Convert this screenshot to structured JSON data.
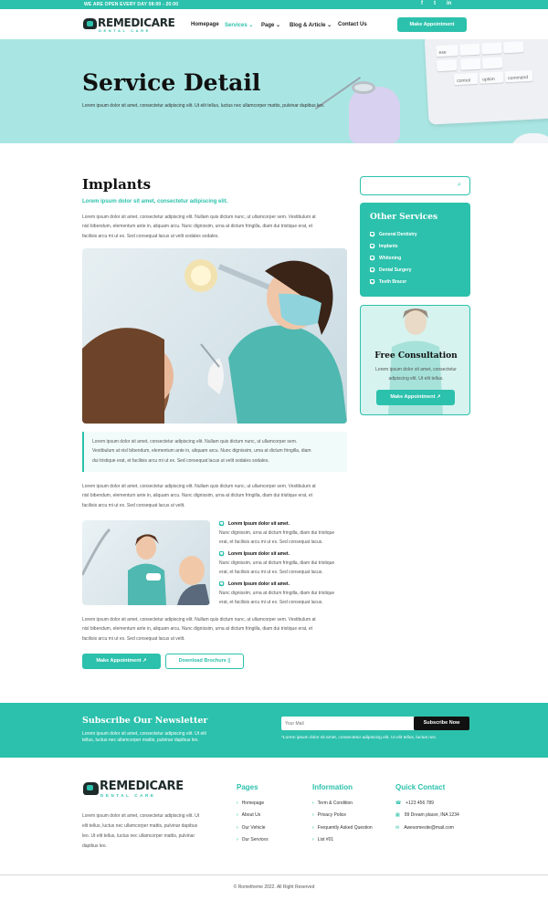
{
  "topbar": {
    "open_text": "WE ARE OPEN EVERY DAY  08:00 - 20:00",
    "social": [
      "f",
      "t",
      "in"
    ]
  },
  "brand": {
    "name": "REMEDICARE",
    "tagline": "DENTAL CARE"
  },
  "nav": {
    "items": [
      "Homepage",
      "Services",
      "Page",
      "Blog & Article",
      "Contact Us"
    ],
    "active": "Services",
    "cta": "Make Appointment"
  },
  "hero": {
    "title": "Service Detail",
    "subtitle": "Lorem ipsum dolor sit amet, consectetur adipiscing elit. Ut elit tellus, luctus nec ullamcorper mattis, pulvinar dapibus leo.",
    "keys": [
      "ese",
      "control",
      "option",
      "command"
    ]
  },
  "main": {
    "title": "Implants",
    "lead": "Lorem ipsum dolor sit amet, consectetur adipiscing elit.",
    "para1": [
      "Lorem ipsum dolor sit amet, consectetur adipiscing elit. Nullam quis dictum nunc, ut ullamcorper sem. Vestibulum at",
      "nisl bibendum, elementum ante in, aliquam arcu. Nunc dignissim, urna at dictum fringilla, diam dui tristique erat, et",
      "facilisis arcu mi ut ex. Sed consequat lacus ut velit sodales sodales."
    ],
    "quote": [
      "Lorem ipsum dolor sit amet, consectetur adipiscing elit. Nullam quis dictum nunc, ut ullamcorper sem.",
      "Vestibulum at nisl bibendum, elementum ante in, aliquam arcu. Nunc dignissim, urna at dictum fringilla, diam",
      "dui tristique erat, et facilisis arcu mi ut ex. Sed consequat lacus ut velit sodales sodales."
    ],
    "para2": [
      "Lorem ipsum dolor sit amet, consectetur adipiscing elit. Nullam quis dictum nunc, ut ullamcorper sem. Vestibulum at",
      "nisl bibendum, elementum ante in, aliquam arcu. Nunc dignissim, urna at dictum fringilla, diam dui tristique erat, et",
      "facilisis arcu mi ut ex. Sed consequat lacus ut velit."
    ],
    "features": [
      {
        "title": "Lorem Ipsum dolor sit amet.",
        "l1": "Nunc dignissim, urna at dictum fringilla, diam dui tristique",
        "l2": "erat, et facilisis arcu mi ut ex. Sed consequat lacus."
      },
      {
        "title": "Lorem Ipsum dolor sit amet.",
        "l1": "Nunc dignissim, urna at dictum fringilla, diam dui tristique",
        "l2": "erat, et facilisis arcu mi ut ex. Sed consequat lacus."
      },
      {
        "title": "Lorem Ipsum dolor sit amet.",
        "l1": "Nunc dignissim, urna at dictum fringilla, diam dui tristique",
        "l2": "erat, et facilisis arcu mi ut ex. Sed consequat lacus."
      }
    ],
    "para3": [
      "Lorem ipsum dolor sit amet, consectetur adipiscing elit. Nullam quis dictum nunc, ut ullamcorper sem. Vestibulum at",
      "nisl bibendum, elementum ante in, aliquam arcu. Nunc dignissim, urna at dictum fringilla, diam dui tristique erat, et",
      "facilisis arcu mi ut ex. Sed consequat lacus ut velit."
    ],
    "btn_appointment": "Make Appointment",
    "btn_brochure": "Download Brochure"
  },
  "sidebar": {
    "search_placeholder": "",
    "other_title": "Other Services",
    "services": [
      "General Dentistry",
      "Implants",
      "Whitening",
      "Dental Surgery",
      "Teeth Bracer"
    ],
    "consult_title": "Free Consultation",
    "consult_text": [
      "Lorem ipsum dolor sit amet, consectetur",
      "adipiscing elit. Ut elit tellus."
    ],
    "consult_btn": "Make Appointment"
  },
  "newsletter": {
    "title": "Subscribe Our Newsletter",
    "text": [
      "Lorem ipsum dolor sit amet, consectetur adipiscing elit. Ut elit",
      "tellus, luctus nec ullamcorper mattis, pulvinar dapibus leo."
    ],
    "placeholder": "Your Mail",
    "button": "Subscribe Now",
    "note": "*Lorem ipsum dolor sit amet, consectetur adipiscing elit. Ut elit tellus, luctus nec."
  },
  "footer": {
    "about": [
      "Lorem ipsum dolor sit amet, consectetur adipiscing elit. Ut",
      "elit tellus, luctus nec ullamcorper mattis, pulvinar dapibus",
      "leo. Ut elit tellus, luctus nec ullamcorper mattis, pulvinar",
      "dapibus leo."
    ],
    "pages_title": "Pages",
    "pages": [
      "Homepage",
      "About Us",
      "Our Vehicle",
      "Our Services"
    ],
    "info_title": "Information",
    "info": [
      "Term & Condition",
      "Privacy Police",
      "Frequently Asked Question",
      "List #01"
    ],
    "contact_title": "Quick Contact",
    "contacts": [
      "+123 456 789",
      "99 Dream placer, INA 1234",
      "Awesomesite@mail.com"
    ],
    "copyright": "© Rometheme 2022. All Right Reserved"
  }
}
